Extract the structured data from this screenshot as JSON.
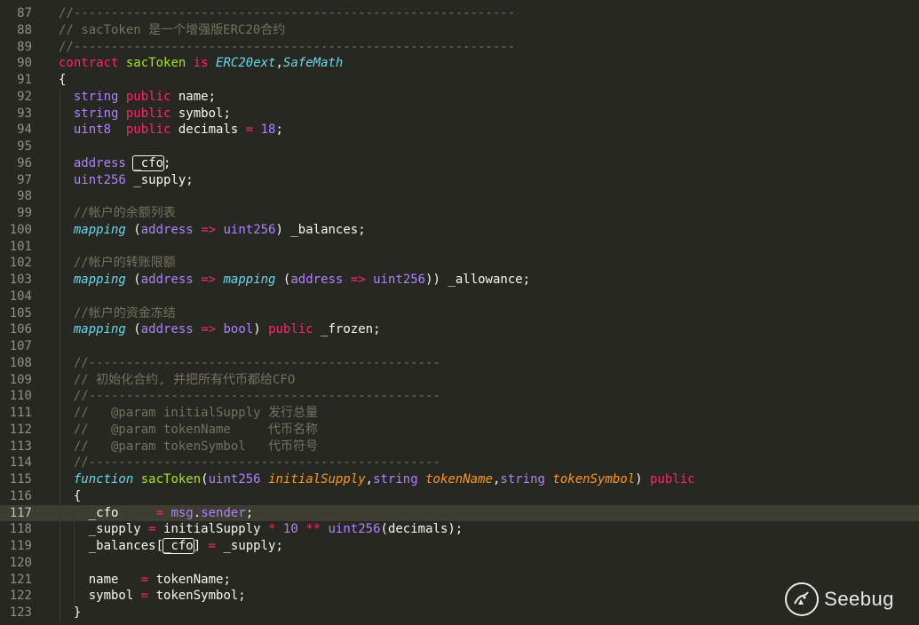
{
  "editor": {
    "language": "solidity",
    "current_line": 117,
    "lines": [
      {
        "n": "87",
        "segs": [
          [
            "c",
            "//-----------------------------------------------------------"
          ]
        ]
      },
      {
        "n": "88",
        "segs": [
          [
            "c",
            "// sacToken 是一个增强版ERC20合约"
          ]
        ]
      },
      {
        "n": "89",
        "segs": [
          [
            "c",
            "//-----------------------------------------------------------"
          ]
        ]
      },
      {
        "n": "90",
        "segs": [
          [
            "k",
            "contract"
          ],
          [
            "",
            " "
          ],
          [
            "cn",
            "sacToken"
          ],
          [
            "",
            " "
          ],
          [
            "k",
            "is"
          ],
          [
            "",
            " "
          ],
          [
            "e",
            "ERC20ext"
          ],
          [
            "",
            ","
          ],
          [
            "e",
            "SafeMath"
          ]
        ]
      },
      {
        "n": "91",
        "segs": [
          [
            "",
            "{"
          ]
        ]
      },
      {
        "n": "92",
        "segs": [
          [
            "",
            "  "
          ],
          [
            "t",
            "string"
          ],
          [
            "",
            " "
          ],
          [
            "k",
            "public"
          ],
          [
            "",
            " name;"
          ]
        ]
      },
      {
        "n": "93",
        "segs": [
          [
            "",
            "  "
          ],
          [
            "t",
            "string"
          ],
          [
            "",
            " "
          ],
          [
            "k",
            "public"
          ],
          [
            "",
            " symbol;"
          ]
        ]
      },
      {
        "n": "94",
        "segs": [
          [
            "",
            "  "
          ],
          [
            "t",
            "uint8"
          ],
          [
            "",
            "  "
          ],
          [
            "k",
            "public"
          ],
          [
            "",
            " decimals "
          ],
          [
            "o",
            "="
          ],
          [
            "",
            " "
          ],
          [
            "n",
            "18"
          ],
          [
            "",
            ";"
          ]
        ]
      },
      {
        "n": "95",
        "segs": []
      },
      {
        "n": "96",
        "segs": [
          [
            "",
            "  "
          ],
          [
            "t",
            "address"
          ],
          [
            "",
            " "
          ],
          [
            "bx",
            "_cfo"
          ],
          [
            "",
            ";"
          ]
        ]
      },
      {
        "n": "97",
        "segs": [
          [
            "",
            "  "
          ],
          [
            "t",
            "uint256"
          ],
          [
            "",
            " _supply;"
          ]
        ]
      },
      {
        "n": "98",
        "segs": []
      },
      {
        "n": "99",
        "segs": [
          [
            "",
            "  "
          ],
          [
            "c",
            "//帐户的余额列表"
          ]
        ]
      },
      {
        "n": "100",
        "segs": [
          [
            "",
            "  "
          ],
          [
            "e",
            "mapping"
          ],
          [
            "",
            " ("
          ],
          [
            "t",
            "address"
          ],
          [
            "",
            " "
          ],
          [
            "o",
            "=>"
          ],
          [
            "",
            " "
          ],
          [
            "t",
            "uint256"
          ],
          [
            "",
            ") _balances;"
          ]
        ]
      },
      {
        "n": "101",
        "segs": []
      },
      {
        "n": "102",
        "segs": [
          [
            "",
            "  "
          ],
          [
            "c",
            "//帐户的转账限额"
          ]
        ]
      },
      {
        "n": "103",
        "segs": [
          [
            "",
            "  "
          ],
          [
            "e",
            "mapping"
          ],
          [
            "",
            " ("
          ],
          [
            "t",
            "address"
          ],
          [
            "",
            " "
          ],
          [
            "o",
            "=>"
          ],
          [
            "",
            " "
          ],
          [
            "e",
            "mapping"
          ],
          [
            "",
            " ("
          ],
          [
            "t",
            "address"
          ],
          [
            "",
            " "
          ],
          [
            "o",
            "=>"
          ],
          [
            "",
            " "
          ],
          [
            "t",
            "uint256"
          ],
          [
            "",
            ")) _allowance;"
          ]
        ]
      },
      {
        "n": "104",
        "segs": []
      },
      {
        "n": "105",
        "segs": [
          [
            "",
            "  "
          ],
          [
            "c",
            "//帐户的资金冻结"
          ]
        ]
      },
      {
        "n": "106",
        "segs": [
          [
            "",
            "  "
          ],
          [
            "e",
            "mapping"
          ],
          [
            "",
            " ("
          ],
          [
            "t",
            "address"
          ],
          [
            "",
            " "
          ],
          [
            "o",
            "=>"
          ],
          [
            "",
            " "
          ],
          [
            "t",
            "bool"
          ],
          [
            "",
            ") "
          ],
          [
            "k",
            "public"
          ],
          [
            "",
            " _frozen;"
          ]
        ]
      },
      {
        "n": "107",
        "segs": []
      },
      {
        "n": "108",
        "segs": [
          [
            "",
            "  "
          ],
          [
            "c",
            "//-----------------------------------------------"
          ]
        ]
      },
      {
        "n": "109",
        "segs": [
          [
            "",
            "  "
          ],
          [
            "c",
            "// 初始化合约, 并把所有代币都给CFO"
          ]
        ]
      },
      {
        "n": "110",
        "segs": [
          [
            "",
            "  "
          ],
          [
            "c",
            "//-----------------------------------------------"
          ]
        ]
      },
      {
        "n": "111",
        "segs": [
          [
            "",
            "  "
          ],
          [
            "c",
            "//   @param initialSupply 发行总量"
          ]
        ]
      },
      {
        "n": "112",
        "segs": [
          [
            "",
            "  "
          ],
          [
            "c",
            "//   @param tokenName     代币名称"
          ]
        ]
      },
      {
        "n": "113",
        "segs": [
          [
            "",
            "  "
          ],
          [
            "c",
            "//   @param tokenSymbol   代币符号"
          ]
        ]
      },
      {
        "n": "114",
        "segs": [
          [
            "",
            "  "
          ],
          [
            "c",
            "//-----------------------------------------------"
          ]
        ]
      },
      {
        "n": "115",
        "segs": [
          [
            "",
            "  "
          ],
          [
            "f",
            "function"
          ],
          [
            "",
            " "
          ],
          [
            "cn",
            "sacToken"
          ],
          [
            "",
            "("
          ],
          [
            "t",
            "uint256"
          ],
          [
            "",
            " "
          ],
          [
            "p",
            "initialSupply"
          ],
          [
            "",
            ","
          ],
          [
            "t",
            "string"
          ],
          [
            "",
            " "
          ],
          [
            "p",
            "tokenName"
          ],
          [
            "",
            ","
          ],
          [
            "t",
            "string"
          ],
          [
            "",
            " "
          ],
          [
            "p",
            "tokenSymbol"
          ],
          [
            "",
            ") "
          ],
          [
            "k",
            "public"
          ]
        ]
      },
      {
        "n": "116",
        "segs": [
          [
            "",
            "  {"
          ]
        ]
      },
      {
        "n": "117",
        "segs": [
          [
            "",
            "    _cfo     "
          ],
          [
            "o",
            "="
          ],
          [
            "",
            " "
          ],
          [
            "t",
            "msg"
          ],
          [
            "",
            "."
          ],
          [
            "t",
            "sender"
          ],
          [
            "",
            ";"
          ]
        ]
      },
      {
        "n": "118",
        "segs": [
          [
            "",
            "    _supply "
          ],
          [
            "o",
            "="
          ],
          [
            "",
            " initialSupply "
          ],
          [
            "o",
            "*"
          ],
          [
            "",
            " "
          ],
          [
            "n",
            "10"
          ],
          [
            "",
            " "
          ],
          [
            "o",
            "**"
          ],
          [
            "",
            " "
          ],
          [
            "t",
            "uint256"
          ],
          [
            "",
            "(decimals);"
          ]
        ]
      },
      {
        "n": "119",
        "segs": [
          [
            "",
            "    _balances["
          ],
          [
            "bx",
            "_cfo"
          ],
          [
            "",
            "] "
          ],
          [
            "o",
            "="
          ],
          [
            "",
            " _supply;"
          ]
        ]
      },
      {
        "n": "120",
        "segs": []
      },
      {
        "n": "121",
        "segs": [
          [
            "",
            "    name   "
          ],
          [
            "o",
            "="
          ],
          [
            "",
            " tokenName;"
          ]
        ]
      },
      {
        "n": "122",
        "segs": [
          [
            "",
            "    symbol "
          ],
          [
            "o",
            "="
          ],
          [
            "",
            " tokenSymbol;"
          ]
        ]
      },
      {
        "n": "123",
        "segs": [
          [
            "",
            "  }"
          ]
        ]
      }
    ]
  },
  "watermark": {
    "text": "Seebug",
    "icon": "seebug-logo-icon"
  },
  "colors": {
    "background": "#272822",
    "current_line": "#3e3d32",
    "comment": "#75715e",
    "keyword": "#f92672",
    "type": "#ae81ff",
    "entity": "#66d9ef",
    "class_name": "#a6e22e",
    "parameter": "#fd971f"
  }
}
